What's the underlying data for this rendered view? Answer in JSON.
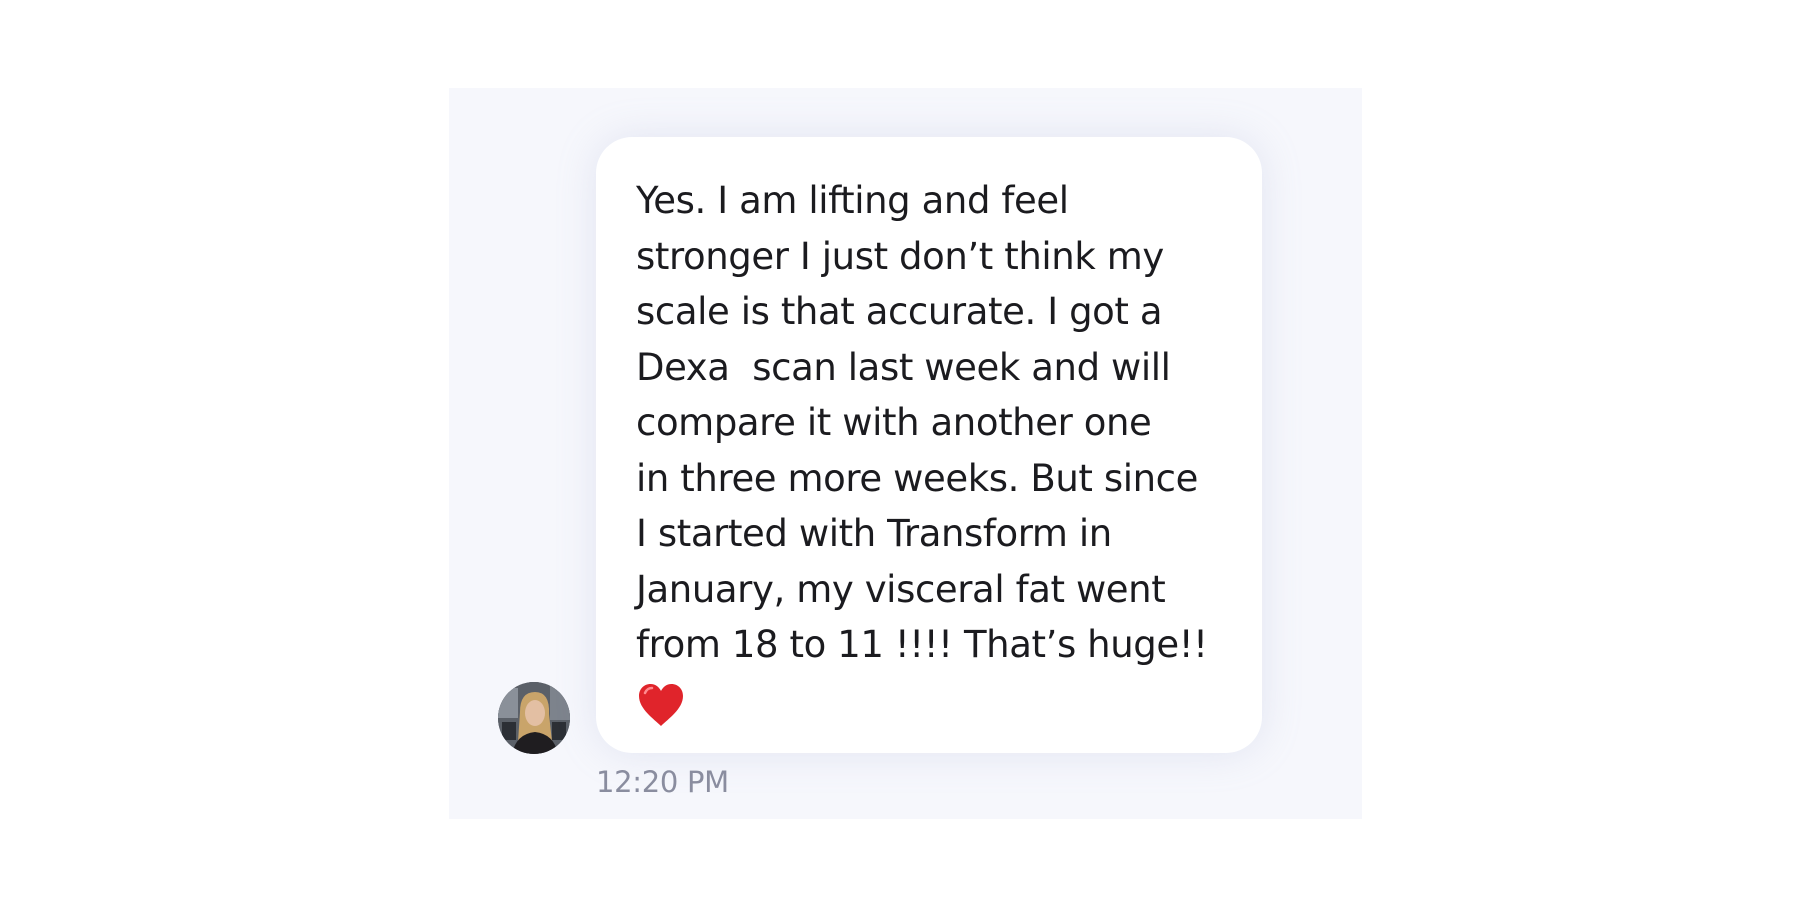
{
  "conversation": {
    "message": {
      "lines": [
        "Yes. I am lifting and feel",
        "stronger I just don’t think my",
        "scale is that accurate. I got a",
        "Dexa  scan last week and will",
        "compare it with another one",
        "in three more weeks. But since",
        "I started with Transform in",
        "January, my visceral fat went",
        "from 18 to 11 !!!! That’s huge!!"
      ],
      "emoji": "heart-icon",
      "timestamp": "12:20 PM"
    },
    "sender": {
      "avatar_icon": "user-avatar"
    }
  },
  "colors": {
    "panel_background": "#f6f7fc",
    "bubble_background": "#ffffff",
    "text": "#1b1b1f",
    "timestamp": "#8a8d9f",
    "heart": "#e0242b"
  }
}
